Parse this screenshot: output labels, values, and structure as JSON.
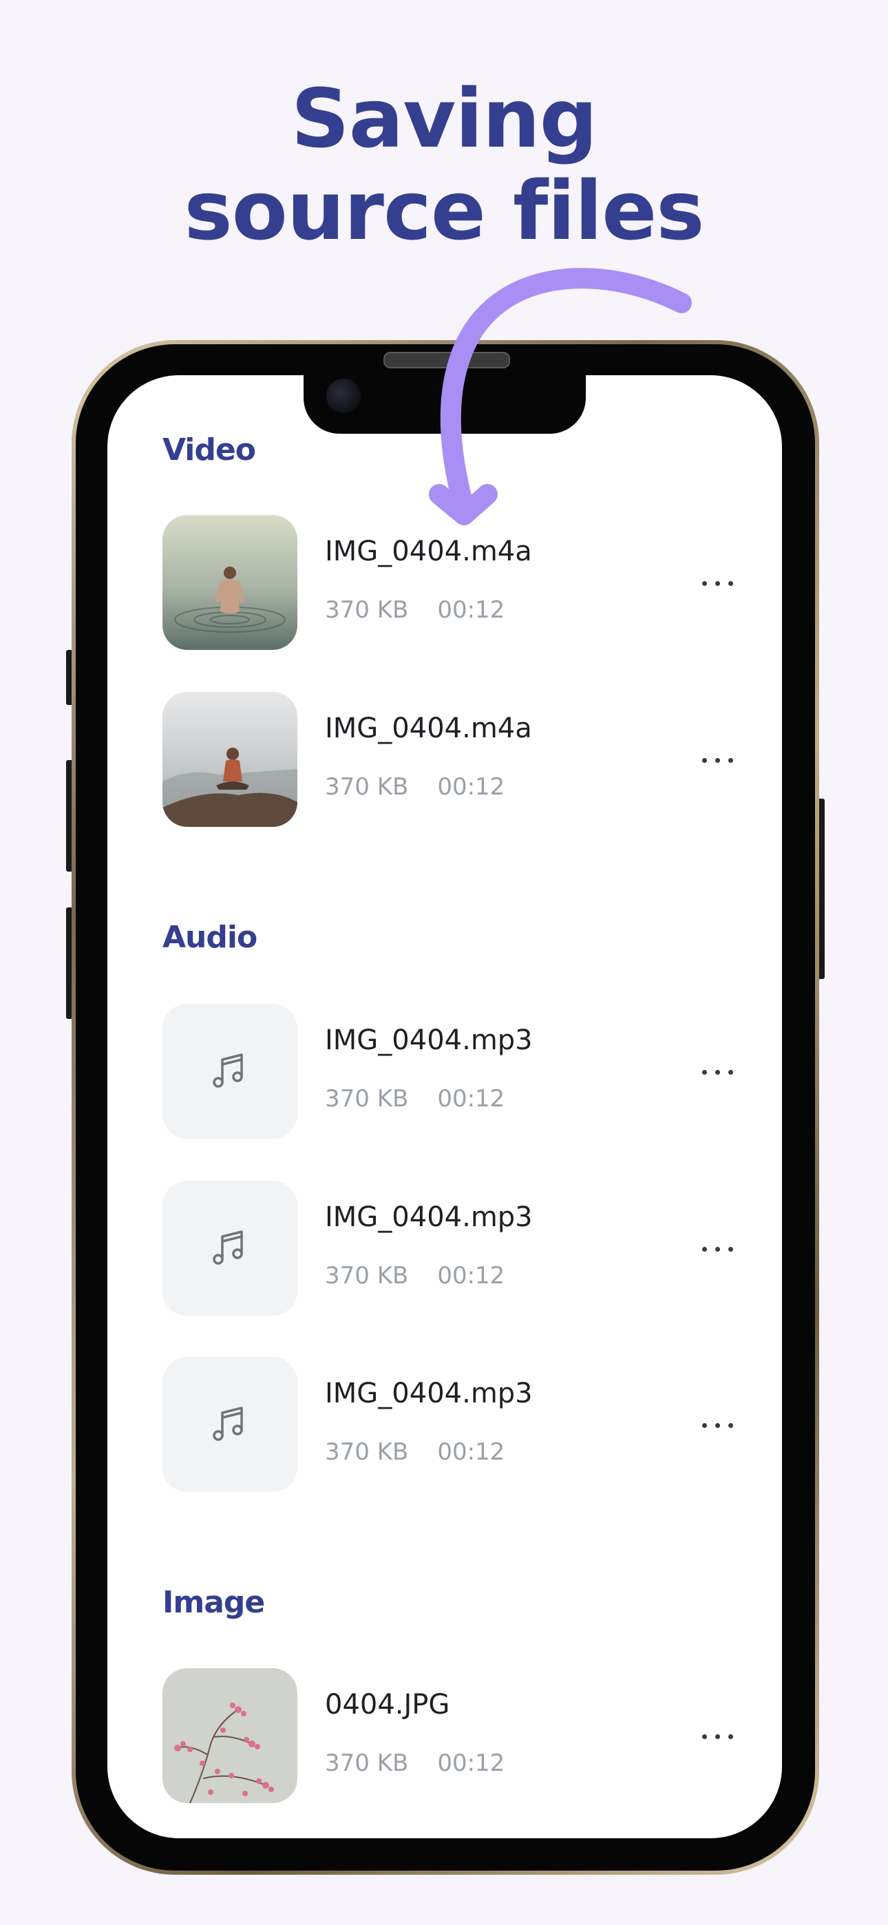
{
  "headline": {
    "line1": "Saving",
    "line2": "source files"
  },
  "colors": {
    "headline": "#343f8f",
    "arrow": "#a98ff4",
    "background": "#f8f4fc"
  },
  "sections": [
    {
      "title": "Video",
      "items": [
        {
          "name": "IMG_0404.m4a",
          "size": "370 KB",
          "duration": "00:12",
          "thumb": "photo-person-in-water"
        },
        {
          "name": "IMG_0404.m4a",
          "size": "370 KB",
          "duration": "00:12",
          "thumb": "photo-person-meditating-on-rock"
        }
      ]
    },
    {
      "title": "Audio",
      "items": [
        {
          "name": "IMG_0404.mp3",
          "size": "370 KB",
          "duration": "00:12",
          "thumb": "music-note-icon"
        },
        {
          "name": "IMG_0404.mp3",
          "size": "370 KB",
          "duration": "00:12",
          "thumb": "music-note-icon"
        },
        {
          "name": "IMG_0404.mp3",
          "size": "370 KB",
          "duration": "00:12",
          "thumb": "music-note-icon"
        }
      ]
    },
    {
      "title": "Image",
      "items": [
        {
          "name": "0404.JPG",
          "size": "370 KB",
          "duration": "00:12",
          "thumb": "photo-pink-blossom-branch"
        }
      ]
    }
  ]
}
